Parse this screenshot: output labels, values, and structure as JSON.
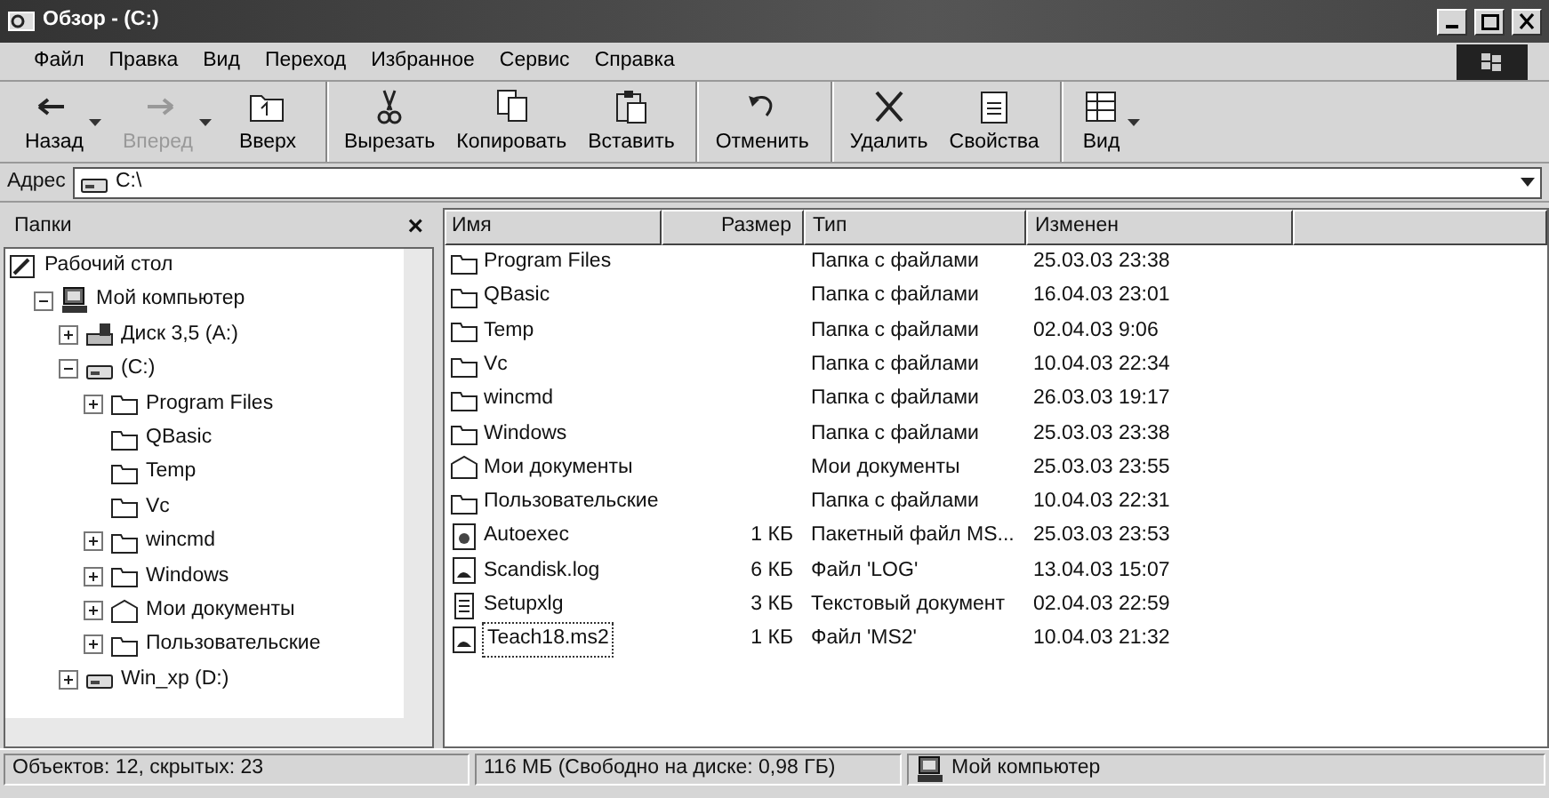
{
  "window": {
    "title": "Обзор - (C:)"
  },
  "menu": [
    "Файл",
    "Правка",
    "Вид",
    "Переход",
    "Избранное",
    "Сервис",
    "Справка"
  ],
  "toolbar": [
    {
      "label": "Назад",
      "kind": "back",
      "disabled": false,
      "dropdown": true,
      "separator_before": false
    },
    {
      "label": "Вперед",
      "kind": "forward",
      "disabled": true,
      "dropdown": true,
      "separator_before": false
    },
    {
      "label": "Вверх",
      "kind": "up",
      "disabled": false,
      "dropdown": false,
      "separator_before": false
    },
    {
      "label": "Вырезать",
      "kind": "cut",
      "disabled": false,
      "dropdown": false,
      "separator_before": true
    },
    {
      "label": "Копировать",
      "kind": "copy",
      "disabled": false,
      "dropdown": false,
      "separator_before": false
    },
    {
      "label": "Вставить",
      "kind": "paste",
      "disabled": false,
      "dropdown": false,
      "separator_before": false
    },
    {
      "label": "Отменить",
      "kind": "undo",
      "disabled": false,
      "dropdown": false,
      "separator_before": true
    },
    {
      "label": "Удалить",
      "kind": "delete",
      "disabled": false,
      "dropdown": false,
      "separator_before": true
    },
    {
      "label": "Свойства",
      "kind": "properties",
      "disabled": false,
      "dropdown": false,
      "separator_before": false
    },
    {
      "label": "Вид",
      "kind": "views",
      "disabled": false,
      "dropdown": true,
      "separator_before": true
    }
  ],
  "address": {
    "label": "Адрес",
    "value": "C:\\"
  },
  "folders_pane": {
    "title": "Папки",
    "close": "×",
    "tree": [
      {
        "label": "Рабочий стол",
        "kind": "desktop",
        "children": [
          {
            "label": "Мой компьютер",
            "kind": "computer",
            "expanded": true,
            "children": [
              {
                "label": "Диск 3,5 (A:)",
                "kind": "floppy",
                "expanded": false
              },
              {
                "label": "(C:)",
                "kind": "drive",
                "expanded": true,
                "children": [
                  {
                    "label": "Program Files",
                    "kind": "folder",
                    "expanded": false
                  },
                  {
                    "label": "QBasic",
                    "kind": "folder"
                  },
                  {
                    "label": "Temp",
                    "kind": "folder"
                  },
                  {
                    "label": "Vc",
                    "kind": "folder"
                  },
                  {
                    "label": "wincmd",
                    "kind": "folder",
                    "expanded": false
                  },
                  {
                    "label": "Windows",
                    "kind": "folder",
                    "expanded": false
                  },
                  {
                    "label": "Мои документы",
                    "kind": "docs",
                    "expanded": false
                  },
                  {
                    "label": "Пользовательские",
                    "kind": "folder",
                    "expanded": false
                  }
                ]
              },
              {
                "label": "Win_xp (D:)",
                "kind": "drive",
                "expanded": false
              }
            ]
          }
        ]
      }
    ]
  },
  "file_list": {
    "columns": [
      "Имя",
      "Размер",
      "Тип",
      "Изменен"
    ],
    "rows": [
      {
        "name": "Program Files",
        "kind": "folder",
        "size": "",
        "type": "Папка с файлами",
        "modified": "25.03.03 23:38",
        "focused": false
      },
      {
        "name": "QBasic",
        "kind": "folder",
        "size": "",
        "type": "Папка с файлами",
        "modified": "16.04.03 23:01",
        "focused": false
      },
      {
        "name": "Temp",
        "kind": "folder",
        "size": "",
        "type": "Папка с файлами",
        "modified": "02.04.03 9:06",
        "focused": false
      },
      {
        "name": "Vc",
        "kind": "folder",
        "size": "",
        "type": "Папка с файлами",
        "modified": "10.04.03 22:34",
        "focused": false
      },
      {
        "name": "wincmd",
        "kind": "folder",
        "size": "",
        "type": "Папка с файлами",
        "modified": "26.03.03 19:17",
        "focused": false
      },
      {
        "name": "Windows",
        "kind": "folder",
        "size": "",
        "type": "Папка с файлами",
        "modified": "25.03.03 23:38",
        "focused": false
      },
      {
        "name": "Мои документы",
        "kind": "docs",
        "size": "",
        "type": "Мои документы",
        "modified": "25.03.03 23:55",
        "focused": false
      },
      {
        "name": "Пользовательские",
        "kind": "folder",
        "size": "",
        "type": "Папка с файлами",
        "modified": "10.04.03 22:31",
        "focused": false
      },
      {
        "name": "Autoexec",
        "kind": "batch",
        "size": "1 КБ",
        "type": "Пакетный файл MS...",
        "modified": "25.03.03 23:53",
        "focused": false
      },
      {
        "name": "Scandisk.log",
        "kind": "file",
        "size": "6 КБ",
        "type": "Файл 'LOG'",
        "modified": "13.04.03 15:07",
        "focused": false
      },
      {
        "name": "Setupxlg",
        "kind": "text",
        "size": "3 КБ",
        "type": "Текстовый документ",
        "modified": "02.04.03 22:59",
        "focused": false
      },
      {
        "name": "Teach18.ms2",
        "kind": "file",
        "size": "1 КБ",
        "type": "Файл 'MS2'",
        "modified": "10.04.03 21:32",
        "focused": true
      }
    ]
  },
  "status_bar": {
    "objects": "Объектов: 12, скрытых: 23",
    "size": "116 МБ (Свободно на диске: 0,98 ГБ)",
    "location": "Мой компьютер"
  }
}
